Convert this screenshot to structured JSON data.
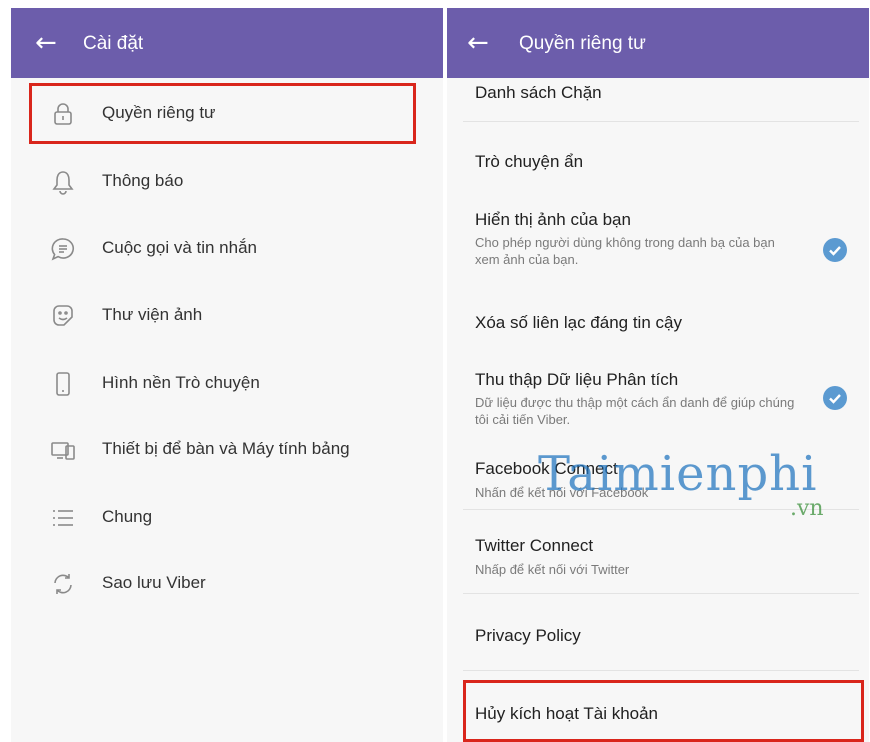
{
  "left_screen": {
    "title": "Cài đặt",
    "items": [
      {
        "label": "Quyền riêng tư",
        "icon": "lock-icon"
      },
      {
        "label": "Thông báo",
        "icon": "bell-icon"
      },
      {
        "label": "Cuộc gọi và tin nhắn",
        "icon": "chat-bubble-icon"
      },
      {
        "label": "Thư viện ảnh",
        "icon": "sticker-icon"
      },
      {
        "label": "Hình nền Trò chuyện",
        "icon": "phone-icon"
      },
      {
        "label": "Thiết bị để bàn và Máy tính bảng",
        "icon": "devices-icon"
      },
      {
        "label": "Chung",
        "icon": "list-icon"
      },
      {
        "label": "Sao lưu Viber",
        "icon": "sync-icon"
      }
    ]
  },
  "right_screen": {
    "title": "Quyền riêng tư",
    "items": [
      {
        "title": "Danh sách Chặn",
        "subtitle": ""
      },
      {
        "title": "Trò chuyện ẩn",
        "subtitle": ""
      },
      {
        "title": "Hiển thị ảnh của bạn",
        "subtitle": "Cho phép người dùng không trong danh bạ của bạn xem ảnh của bạn.",
        "checked": true
      },
      {
        "title": "Xóa số liên lạc đáng tin cậy",
        "subtitle": ""
      },
      {
        "title": "Thu thập Dữ liệu Phân tích",
        "subtitle": "Dữ liệu được thu thập một cách ẩn danh để giúp chúng tôi cải tiến Viber.",
        "checked": true
      },
      {
        "title": "Facebook Connect",
        "subtitle": "Nhấn để kết nối với Facebook"
      },
      {
        "title": "Twitter Connect",
        "subtitle": "Nhấp để kết nối với Twitter"
      },
      {
        "title": "Privacy Policy",
        "subtitle": ""
      },
      {
        "title": "Hủy kích hoạt Tài khoản",
        "subtitle": ""
      }
    ]
  },
  "watermark": {
    "main": "Taimienphi",
    "sub": ".vn"
  },
  "colors": {
    "app_bar": "#6c5dab",
    "highlight_border": "#d9261c",
    "check": "#5b9ad1",
    "icon_stroke": "#8a8a8a"
  }
}
